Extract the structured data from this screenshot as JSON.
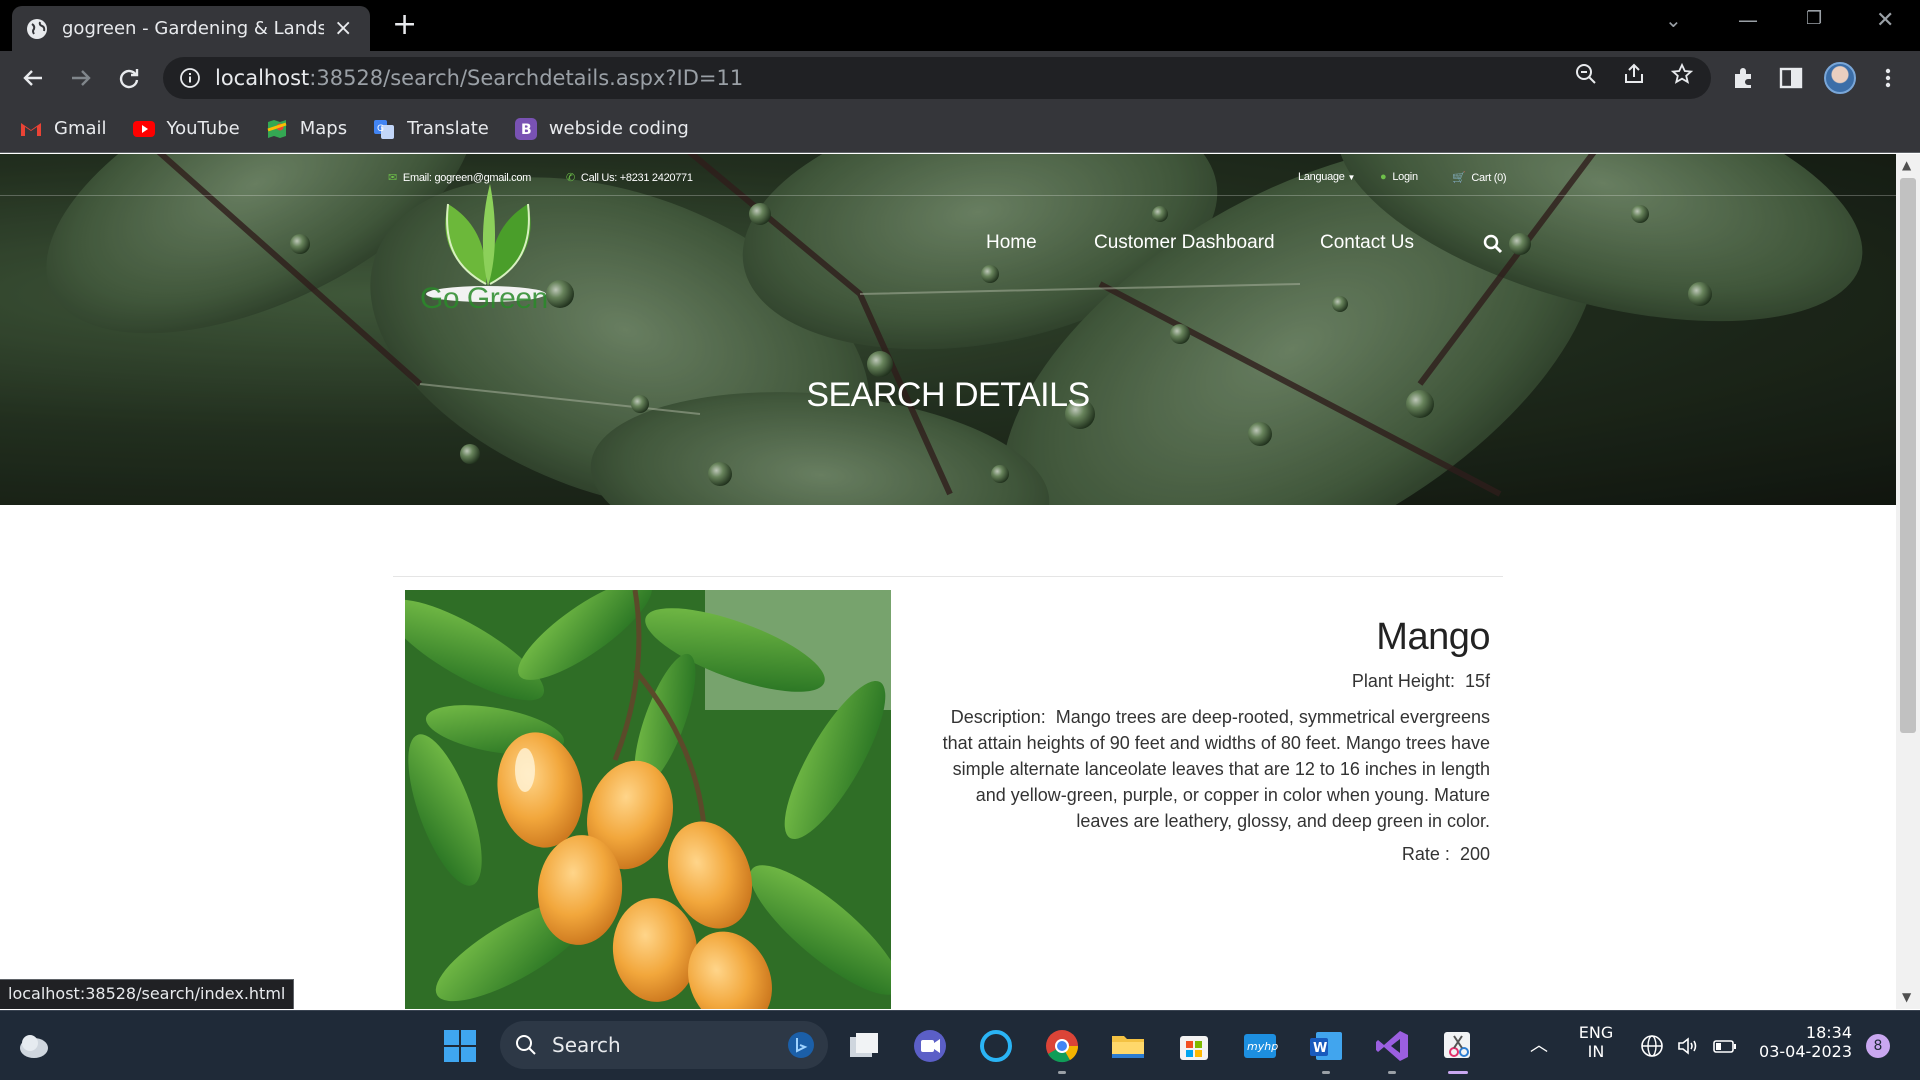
{
  "browser": {
    "tab_title": "gogreen - Gardening & Landscap",
    "url_host": "localhost",
    "url_path": ":38528/search/Searchdetails.aspx?ID=11",
    "bookmarks": [
      "Gmail",
      "YouTube",
      "Maps",
      "Translate",
      "webside coding"
    ],
    "status_url": "localhost:38528/search/index.html"
  },
  "site": {
    "topbar": {
      "email": "Email: gogreen@gmail.com",
      "phone": "Call Us: +8231 2420771",
      "language": "Language",
      "login": "Login",
      "cart": "Cart (0)"
    },
    "logo_text": "Go Green",
    "nav": [
      "Home",
      "Customer Dashboard",
      "Contact Us"
    ],
    "hero_title": "SEARCH DETAILS"
  },
  "product": {
    "name": "Mango",
    "height_label": "Plant Height:",
    "height_value": "15f",
    "description_label": "Description:",
    "description": "Mango trees are deep-rooted, symmetrical evergreens that attain heights of 90 feet and widths of 80 feet. Mango trees have simple alternate lanceolate leaves that are 12 to 16 inches in length and yellow-green, purple, or copper in color when young. Mature leaves are leathery, glossy, and deep green in color.",
    "rate_label": "Rate :",
    "rate_value": "200"
  },
  "taskbar": {
    "search_label": "Search",
    "lang_top": "ENG",
    "lang_bottom": "IN",
    "time": "18:34",
    "date": "03-04-2023",
    "notification_count": "8"
  },
  "colors": {
    "accent_green": "#6ec04a",
    "chrome_dark": "#35363a",
    "taskbar": "#1f2a38"
  }
}
